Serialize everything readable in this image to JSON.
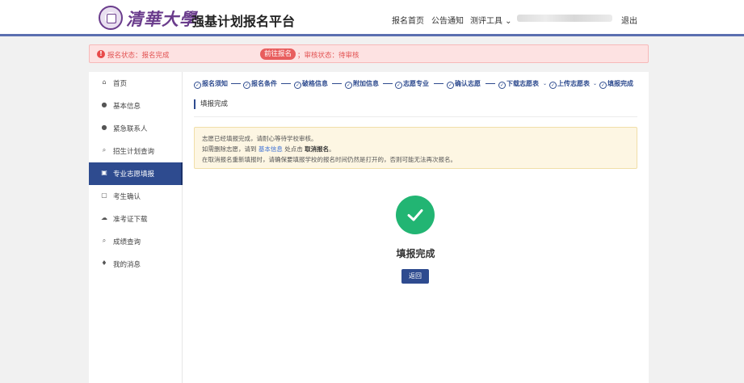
{
  "header": {
    "logo_text": "清華大學",
    "site_title": "强基计划报名平台",
    "nav_home": "报名首页",
    "nav_notice": "公告通知",
    "nav_tools": "测评工具 ⌄",
    "nav_logout": "退出"
  },
  "status": {
    "text_1": "报名状态：报名完成",
    "button": "前往报名",
    "text_2": "；审核状态：待审核"
  },
  "sidebar": {
    "items": [
      {
        "label": "首页",
        "icon": "⌂"
      },
      {
        "label": "基本信息",
        "icon": "●"
      },
      {
        "label": "紧急联系人",
        "icon": "●"
      },
      {
        "label": "招生计划查询",
        "icon": "⌕"
      },
      {
        "label": "专业志愿填报",
        "icon": "▣"
      },
      {
        "label": "考生确认",
        "icon": "▢"
      },
      {
        "label": "准考证下载",
        "icon": "☁"
      },
      {
        "label": "成绩查询",
        "icon": "⌕"
      },
      {
        "label": "我的消息",
        "icon": "♦"
      }
    ]
  },
  "steps": [
    "报名须知",
    "报名条件",
    "破格信息",
    "附加信息",
    "志愿专业",
    "确认志愿",
    "下载志愿表",
    "上传志愿表",
    "填报完成"
  ],
  "main": {
    "section_title": "填报完成",
    "notice_1": "志愿已经填报完成，请耐心等待学校审核。",
    "notice_2a": "如需删除志愿，请到",
    "notice_2_link": "基本信息",
    "notice_2b": "处点击",
    "notice_2_strong": "取消报名",
    "notice_2c": "。",
    "notice_3": "在取消报名重新填报时，请确保要填报学校的报名时间仍然是打开的，否则可能无法再次报名。",
    "done_text": "填报完成",
    "back_button": "返回"
  }
}
